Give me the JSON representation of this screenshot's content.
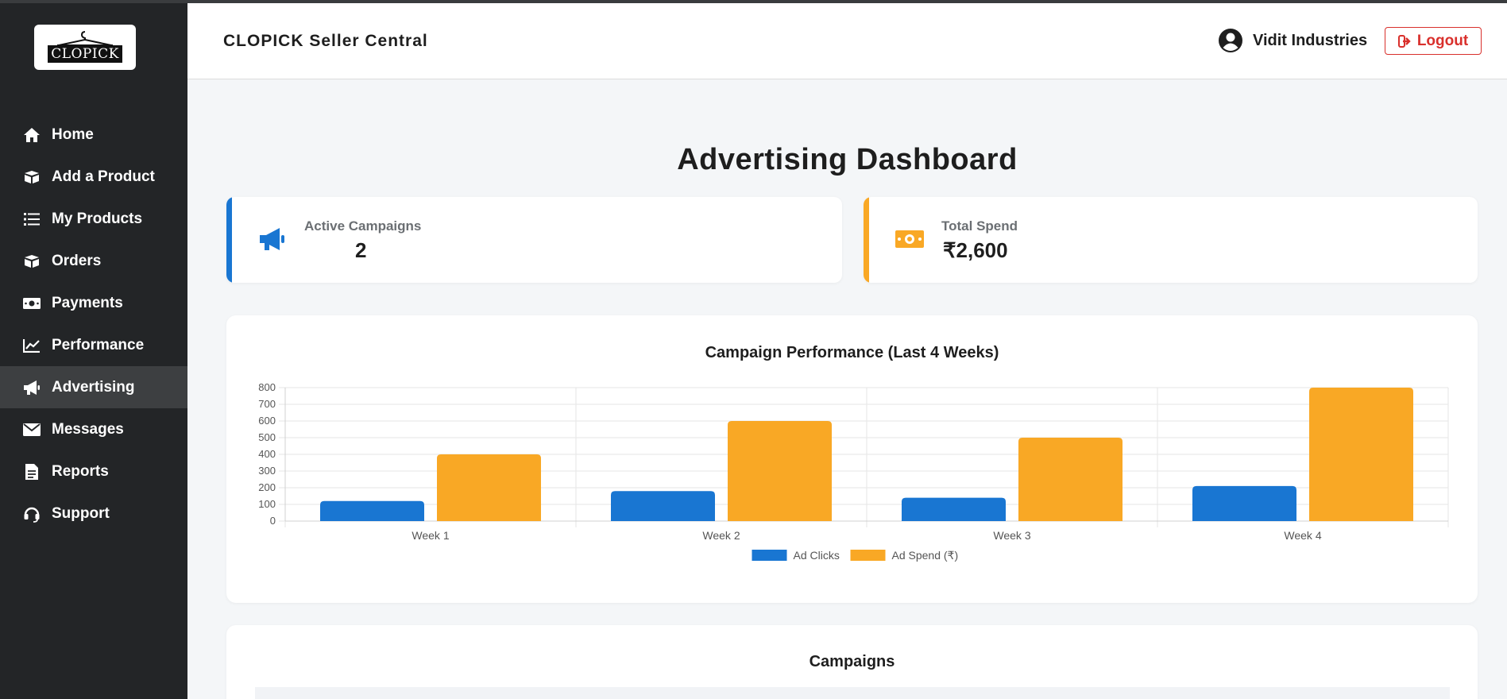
{
  "logo": {
    "text": "CLOPICK"
  },
  "sidebar": {
    "items": [
      {
        "label": "Home",
        "icon": "home-icon"
      },
      {
        "label": "Add a Product",
        "icon": "box-icon"
      },
      {
        "label": "My Products",
        "icon": "list-icon"
      },
      {
        "label": "Orders",
        "icon": "box-icon"
      },
      {
        "label": "Payments",
        "icon": "money-icon"
      },
      {
        "label": "Performance",
        "icon": "chart-line-icon"
      },
      {
        "label": "Advertising",
        "icon": "megaphone-icon",
        "active": true
      },
      {
        "label": "Messages",
        "icon": "envelope-icon"
      },
      {
        "label": "Reports",
        "icon": "file-icon"
      },
      {
        "label": "Support",
        "icon": "headset-icon"
      }
    ]
  },
  "header": {
    "brand": "CLOPICK Seller Central",
    "user_name": "Vidit Industries",
    "logout_label": "Logout"
  },
  "page": {
    "title": "Advertising Dashboard"
  },
  "stats": {
    "active_campaigns": {
      "label": "Active Campaigns",
      "value": "2",
      "color": "#1976d2"
    },
    "total_spend": {
      "label": "Total Spend",
      "value": "₹2,600",
      "color": "#f9a825"
    }
  },
  "colors": {
    "accent_blue": "#1976d2",
    "accent_orange": "#f9a825",
    "sidebar_bg": "#232527",
    "logout_red": "#d9302c"
  },
  "chart_data": {
    "type": "bar",
    "title": "Campaign Performance (Last 4 Weeks)",
    "categories": [
      "Week 1",
      "Week 2",
      "Week 3",
      "Week 4"
    ],
    "series": [
      {
        "name": "Ad Clicks",
        "values": [
          120,
          180,
          140,
          210
        ],
        "color": "#1976d2"
      },
      {
        "name": "Ad Spend (₹)",
        "values": [
          400,
          600,
          500,
          800
        ],
        "color": "#f9a825"
      }
    ],
    "ylim": [
      0,
      800
    ],
    "yticks": [
      0,
      100,
      200,
      300,
      400,
      500,
      600,
      700,
      800
    ],
    "grid": true,
    "legend": "bottom"
  },
  "campaigns": {
    "title": "Campaigns"
  }
}
